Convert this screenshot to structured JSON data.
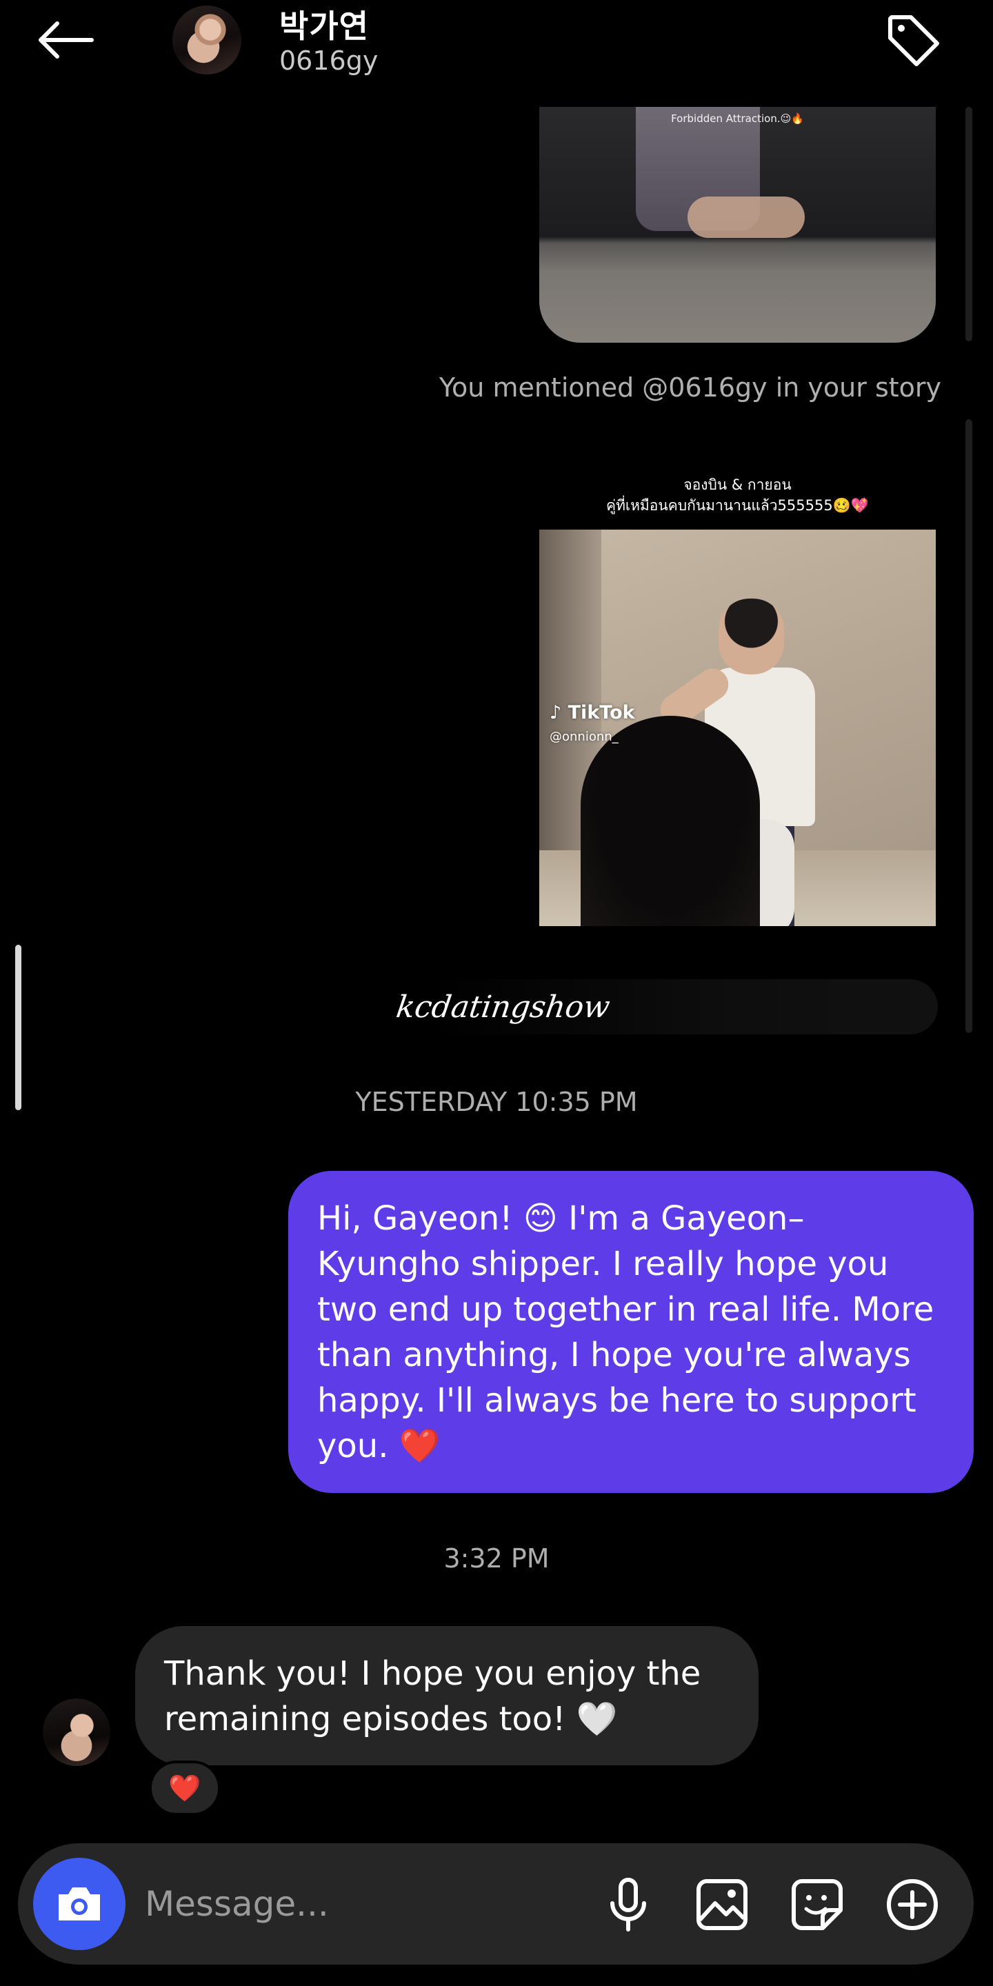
{
  "header": {
    "name": "박가연",
    "username": "0616gy"
  },
  "thread": {
    "top_media_caption": "Forbidden Attraction.😉🔥",
    "mention_note": "You mentioned @0616gy in your story",
    "story_caption_line1": "จองบิน & กายอน",
    "story_caption_line2": "คู่ที่เหมือนคบกันมานานแล้ว555555🥴💖",
    "tiktok_logo": "TikTok",
    "tiktok_user": "@onnionn_",
    "watermark": "kcdatingshow",
    "timestamp_1": "YESTERDAY 10:35 PM",
    "outgoing_message": "Hi, Gayeon! 😊 I'm a Gayeon–Kyungho shipper. I really hope you two end up together in real life. More than anything, I hope you're always happy. I'll always be here to support you. ❤️",
    "timestamp_2": "3:32 PM",
    "incoming_message": "Thank you! I hope you enjoy the remaining episodes too! 🤍",
    "reaction": "❤️"
  },
  "composer": {
    "placeholder": "Message..."
  },
  "colors": {
    "outgoing_bubble": "#5e3ce8",
    "incoming_bubble": "#262626",
    "camera_button": "#3d5bf0",
    "background": "#000000"
  },
  "icons": [
    "back-arrow-icon",
    "tag-icon",
    "camera-icon",
    "microphone-icon",
    "gallery-icon",
    "sticker-icon",
    "plus-circle-icon"
  ]
}
